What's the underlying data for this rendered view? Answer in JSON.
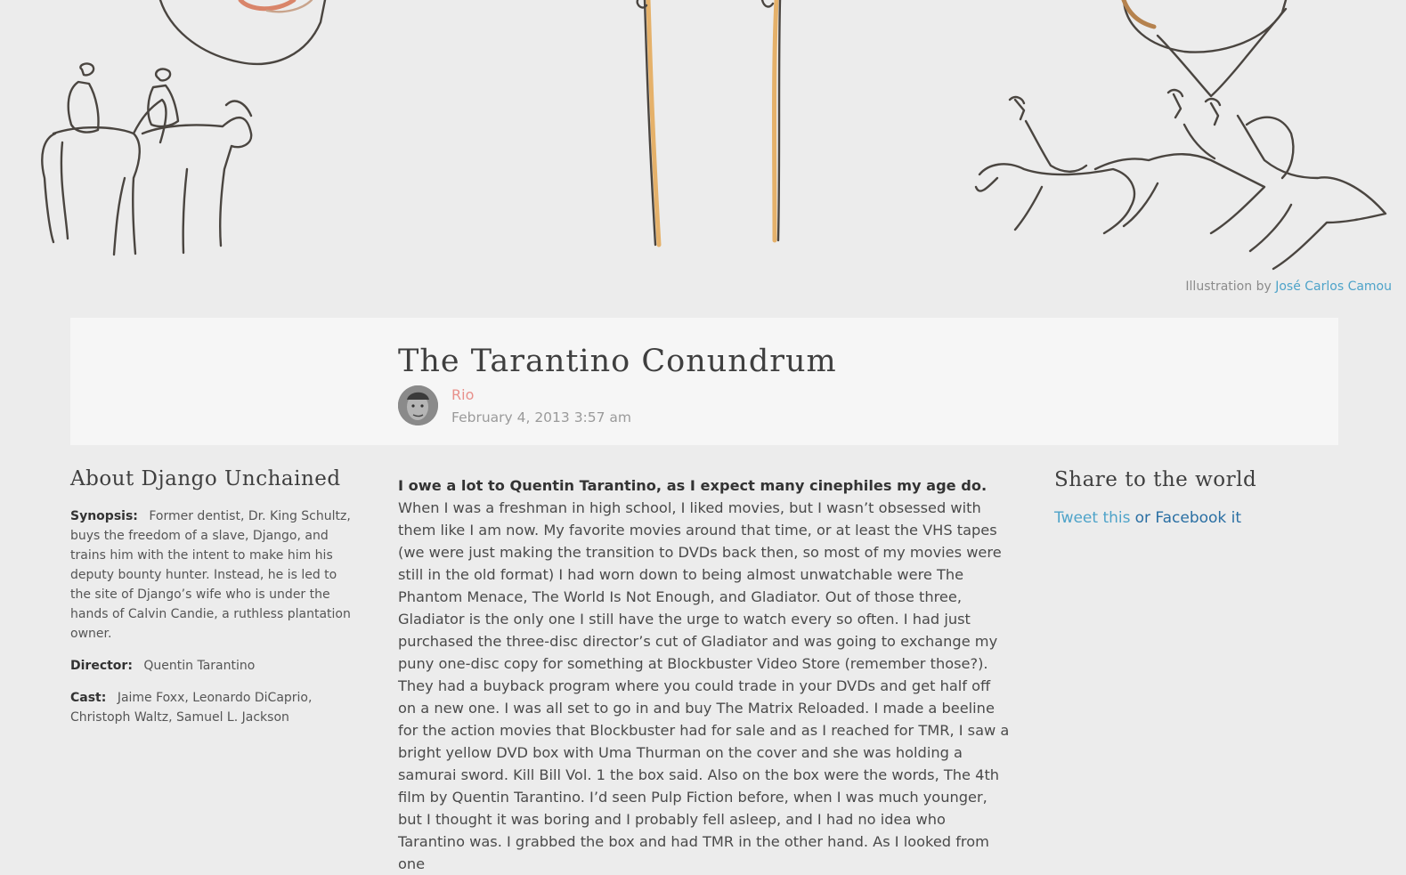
{
  "hero": {
    "illustration_credit_prefix": "Illustration by",
    "illustrator": "José Carlos Camou"
  },
  "post": {
    "title": "The Tarantino Conundrum",
    "author": "Rio",
    "date": "February 4, 2013 3:57 am",
    "lead": "I owe a lot to Quentin Tarantino, as I expect many cinephiles my age do.",
    "body": "When I was a freshman in high school, I liked movies, but I wasn’t obsessed with them like I am now. My favorite movies around that time, or at least the VHS tapes (we were just making the transition to DVDs back then, so most of my movies were still in the old format) I had worn down to being almost unwatchable were The Phantom Menace, The World Is Not Enough, and Gladiator. Out of those three, Gladiator is the only one I still have the urge to watch every so often. I had just purchased the three-disc director’s cut of Gladiator and was going to exchange my puny one-disc copy for something at Blockbuster Video Store (remember those?). They had a buyback program where you could trade in your DVDs and get half off on a new one. I was all set to go in and buy The Matrix Reloaded. I made a beeline for the action movies that Blockbuster had for sale and as I reached for TMR, I saw a bright yellow DVD box with Uma Thurman on the cover and she was holding a samurai sword. Kill Bill Vol. 1 the box said. Also on the box were the words, The 4th film by Quentin Tarantino. I’d seen Pulp Fiction before, when I was much younger, but I thought it was boring and I probably fell asleep, and I had no idea who Tarantino was. I grabbed the box and had TMR in the other hand. As I looked from one"
  },
  "about": {
    "heading": "About Django Unchained",
    "synopsis_label": "Synopsis:",
    "synopsis": "Former dentist, Dr. King Schultz, buys the freedom of a slave, Django, and trains him with the intent to make him his deputy bounty hunter. Instead, he is led to the site of Django’s wife who is under the hands of Calvin Candie, a ruthless plantation owner.",
    "director_label": "Director:",
    "director": "Quentin Tarantino",
    "cast_label": "Cast:",
    "cast": "Jaime Foxx, Leonardo DiCaprio, Christoph Waltz, Samuel L. Jackson"
  },
  "share": {
    "heading": "Share to the world",
    "tweet": "Tweet this",
    "facebook": "or Facebook it"
  }
}
